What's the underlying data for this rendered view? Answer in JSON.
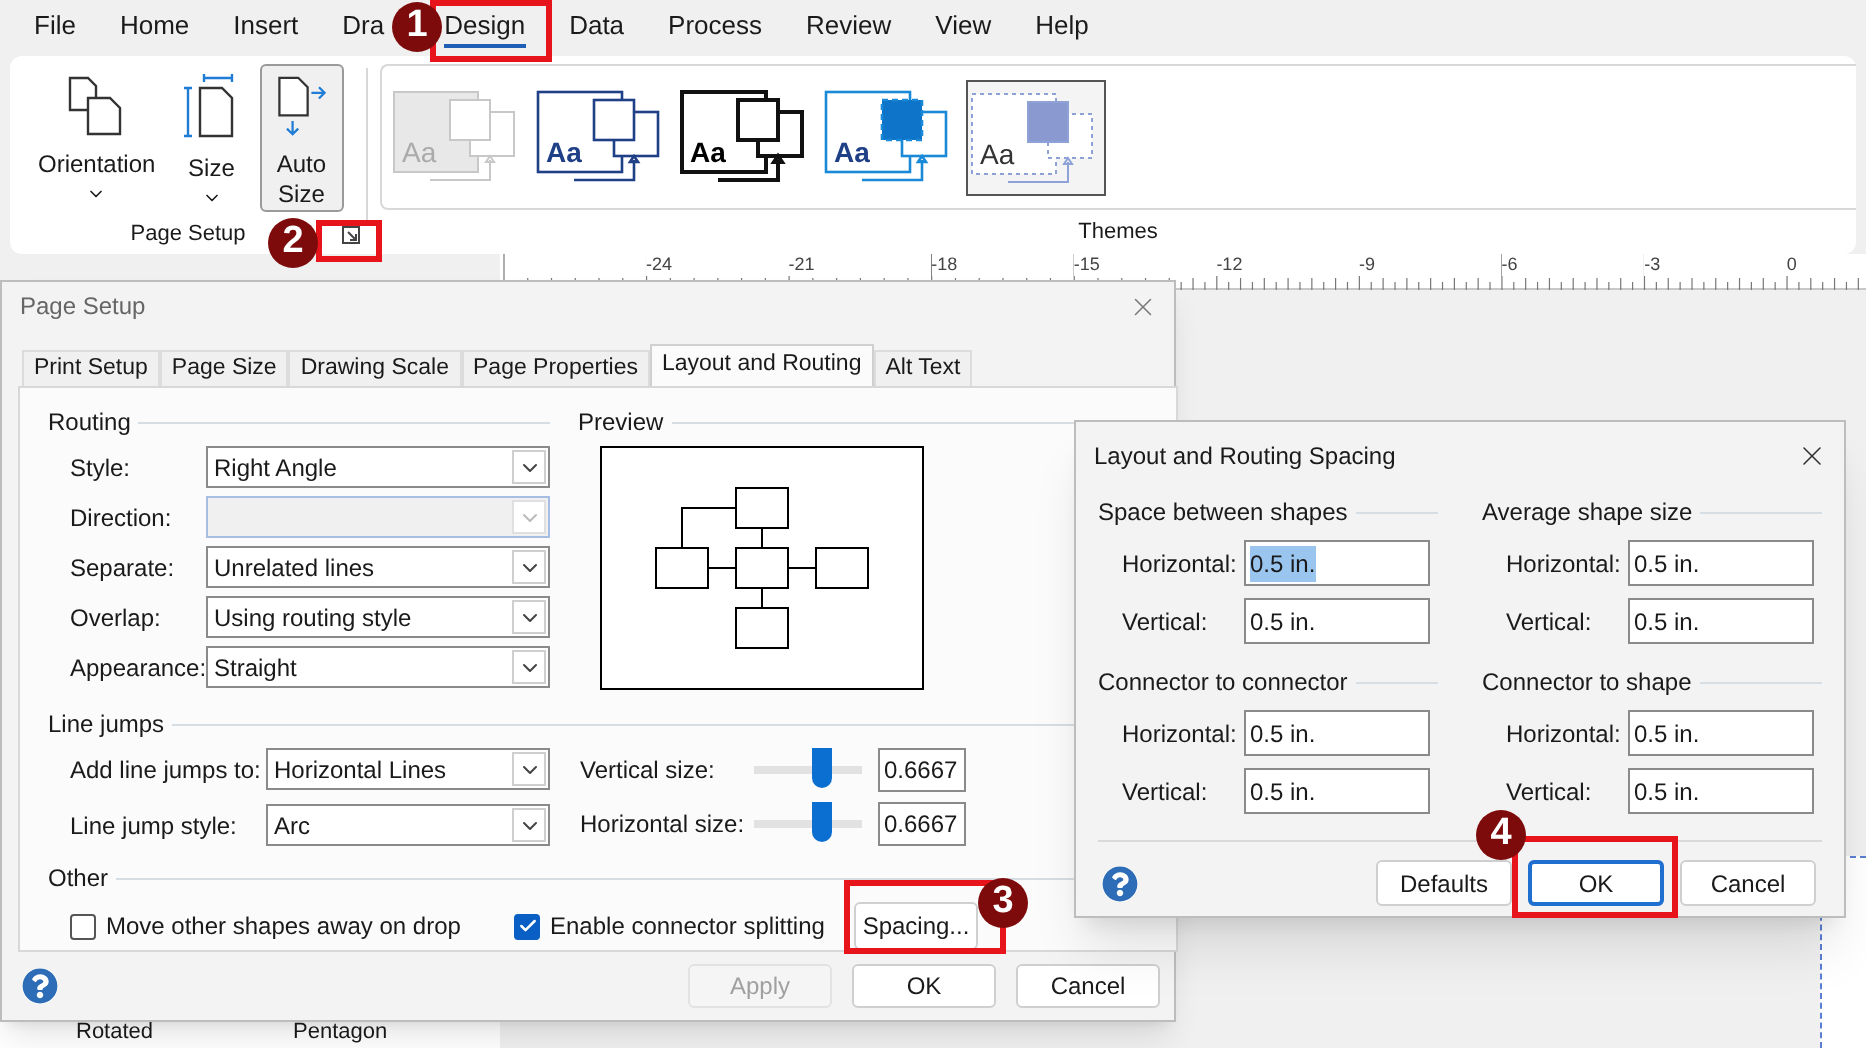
{
  "menu": [
    {
      "label": "File",
      "selected": false
    },
    {
      "label": "Home",
      "selected": false
    },
    {
      "label": "Insert",
      "selected": false
    },
    {
      "label": "Dra",
      "selected": false
    },
    {
      "label": "Design",
      "selected": true
    },
    {
      "label": "Data",
      "selected": false
    },
    {
      "label": "Process",
      "selected": false
    },
    {
      "label": "Review",
      "selected": false
    },
    {
      "label": "View",
      "selected": false
    },
    {
      "label": "Help",
      "selected": false
    }
  ],
  "ribbon": {
    "page_setup": {
      "label": "Page Setup",
      "buttons": [
        {
          "kind": "orientation",
          "label": "Orientation",
          "dropdown": true,
          "selected": false
        },
        {
          "kind": "size",
          "label": "Size",
          "dropdown": true,
          "selected": false
        },
        {
          "kind": "autosize",
          "label": "Auto Size",
          "dropdown": false,
          "selected": true
        }
      ]
    },
    "themes": {
      "label": "Themes",
      "items": [
        {
          "kind": "faded",
          "text": "Aa",
          "selected": false
        },
        {
          "kind": "navy",
          "text": "Aa",
          "selected": false
        },
        {
          "kind": "sketch",
          "text": "Aa",
          "selected": false
        },
        {
          "kind": "blue",
          "text": "Aa",
          "selected": false
        },
        {
          "kind": "dotted",
          "text": "Aa",
          "selected": true
        }
      ]
    }
  },
  "ruler": [
    "-24",
    "-21",
    "-18",
    "-15",
    "-12",
    "-9",
    "-6",
    "-3",
    "0"
  ],
  "stencil": [
    "Rotated",
    "Pentagon"
  ],
  "page_setup": {
    "title": "Page Setup",
    "tabs": [
      {
        "label": "Print Setup",
        "selected": false
      },
      {
        "label": "Page Size",
        "selected": false
      },
      {
        "label": "Drawing Scale",
        "selected": false
      },
      {
        "label": "Page Properties",
        "selected": false
      },
      {
        "label": "Layout and Routing",
        "selected": true
      },
      {
        "label": "Alt Text",
        "selected": false
      }
    ],
    "routing": {
      "label": "Routing",
      "fields": [
        {
          "label": "Style:",
          "value": "Right Angle",
          "disabled": false
        },
        {
          "label": "Direction:",
          "disabled": true
        },
        {
          "label": "Separate:",
          "value": "Unrelated lines",
          "disabled": false
        },
        {
          "label": "Overlap:",
          "value": "Using routing style",
          "disabled": false
        },
        {
          "label": "Appearance:",
          "value": "Straight",
          "disabled": false
        }
      ]
    },
    "preview": {
      "label": "Preview"
    },
    "line_jumps": {
      "label": "Line jumps",
      "fields": [
        {
          "label": "Add line jumps to:",
          "value": "Horizontal Lines"
        },
        {
          "label": "Line jump style:",
          "value": "Arc"
        }
      ],
      "sizes": [
        {
          "label": "Vertical size:",
          "level": 0.63,
          "value": "0.6667"
        },
        {
          "label": "Horizontal size:",
          "level": 0.63,
          "value": "0.6667"
        }
      ]
    },
    "other": {
      "label": "Other",
      "checkboxes": [
        {
          "label": "Move other shapes away on drop",
          "checked": false
        },
        {
          "label": "Enable connector splitting",
          "checked": true
        }
      ],
      "button": "Spacing..."
    },
    "buttons": [
      {
        "label": "Apply",
        "disabled": true
      },
      {
        "label": "OK",
        "disabled": false
      },
      {
        "label": "Cancel",
        "disabled": false
      }
    ]
  },
  "spacing": {
    "title": "Layout and Routing Spacing",
    "groups": [
      {
        "label": "Space between shapes",
        "fields": [
          {
            "label": "Horizontal:",
            "value": "0.5 in.",
            "selected": true
          },
          {
            "label": "Vertical:",
            "value": "0.5 in.",
            "selected": false
          }
        ]
      },
      {
        "label": "Average shape size",
        "fields": [
          {
            "label": "Horizontal:",
            "value": "0.5 in.",
            "selected": false
          },
          {
            "label": "Vertical:",
            "value": "0.5 in.",
            "selected": false
          }
        ]
      },
      {
        "label": "Connector to connector",
        "fields": [
          {
            "label": "Horizontal:",
            "value": "0.5 in.",
            "selected": false
          },
          {
            "label": "Vertical:",
            "value": "0.5 in.",
            "selected": false
          }
        ]
      },
      {
        "label": "Connector to shape",
        "fields": [
          {
            "label": "Horizontal:",
            "value": "0.5 in.",
            "selected": false
          },
          {
            "label": "Vertical:",
            "value": "0.5 in.",
            "selected": false
          }
        ]
      }
    ],
    "buttons": [
      {
        "label": "Defaults",
        "focused": false
      },
      {
        "label": "OK",
        "focused": true
      },
      {
        "label": "Cancel",
        "focused": false
      }
    ]
  },
  "annotations": [
    {
      "number": "1"
    },
    {
      "number": "2"
    },
    {
      "number": "3"
    },
    {
      "number": "4"
    }
  ]
}
